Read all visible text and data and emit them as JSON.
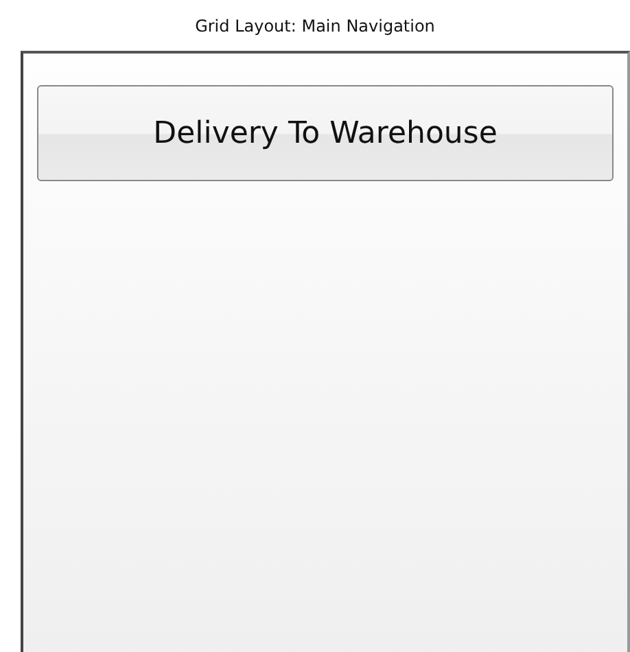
{
  "title": "Grid Layout: Main Navigation",
  "buttons": [
    {
      "label": "Delivery To Warehouse"
    }
  ]
}
